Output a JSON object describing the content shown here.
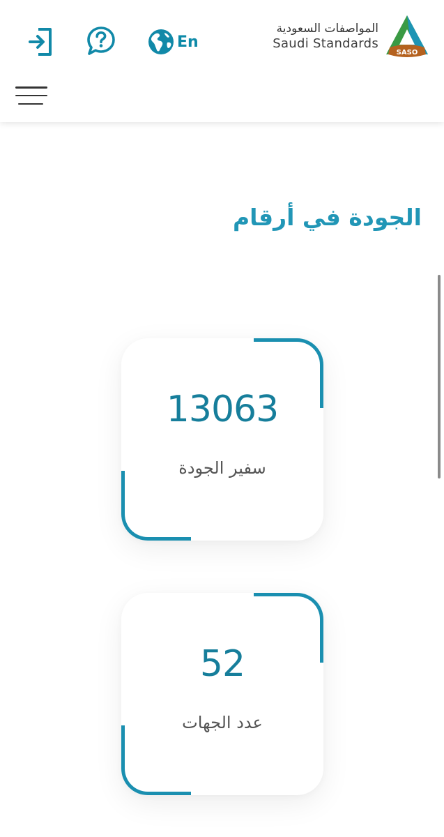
{
  "header": {
    "language_label": "En",
    "brand": {
      "name_ar": "المواصفات السعودية",
      "name_en": "Saudi Standards",
      "logo_text": "SASO"
    },
    "icons": {
      "login": "login-icon",
      "help": "help-chat-icon",
      "globe": "globe-icon",
      "menu": "hamburger-menu-icon"
    }
  },
  "section": {
    "title": "الجودة في أرقام"
  },
  "stats": [
    {
      "value": "13063",
      "label": "سفير الجودة"
    },
    {
      "value": "52",
      "label": "عدد الجهات"
    }
  ],
  "colors": {
    "accent": "#1a8fb0",
    "title": "#2196b6",
    "number": "#167e9b",
    "logo_green": "#3a9a44",
    "logo_teal": "#1d94b4",
    "logo_orange": "#b5621f"
  }
}
